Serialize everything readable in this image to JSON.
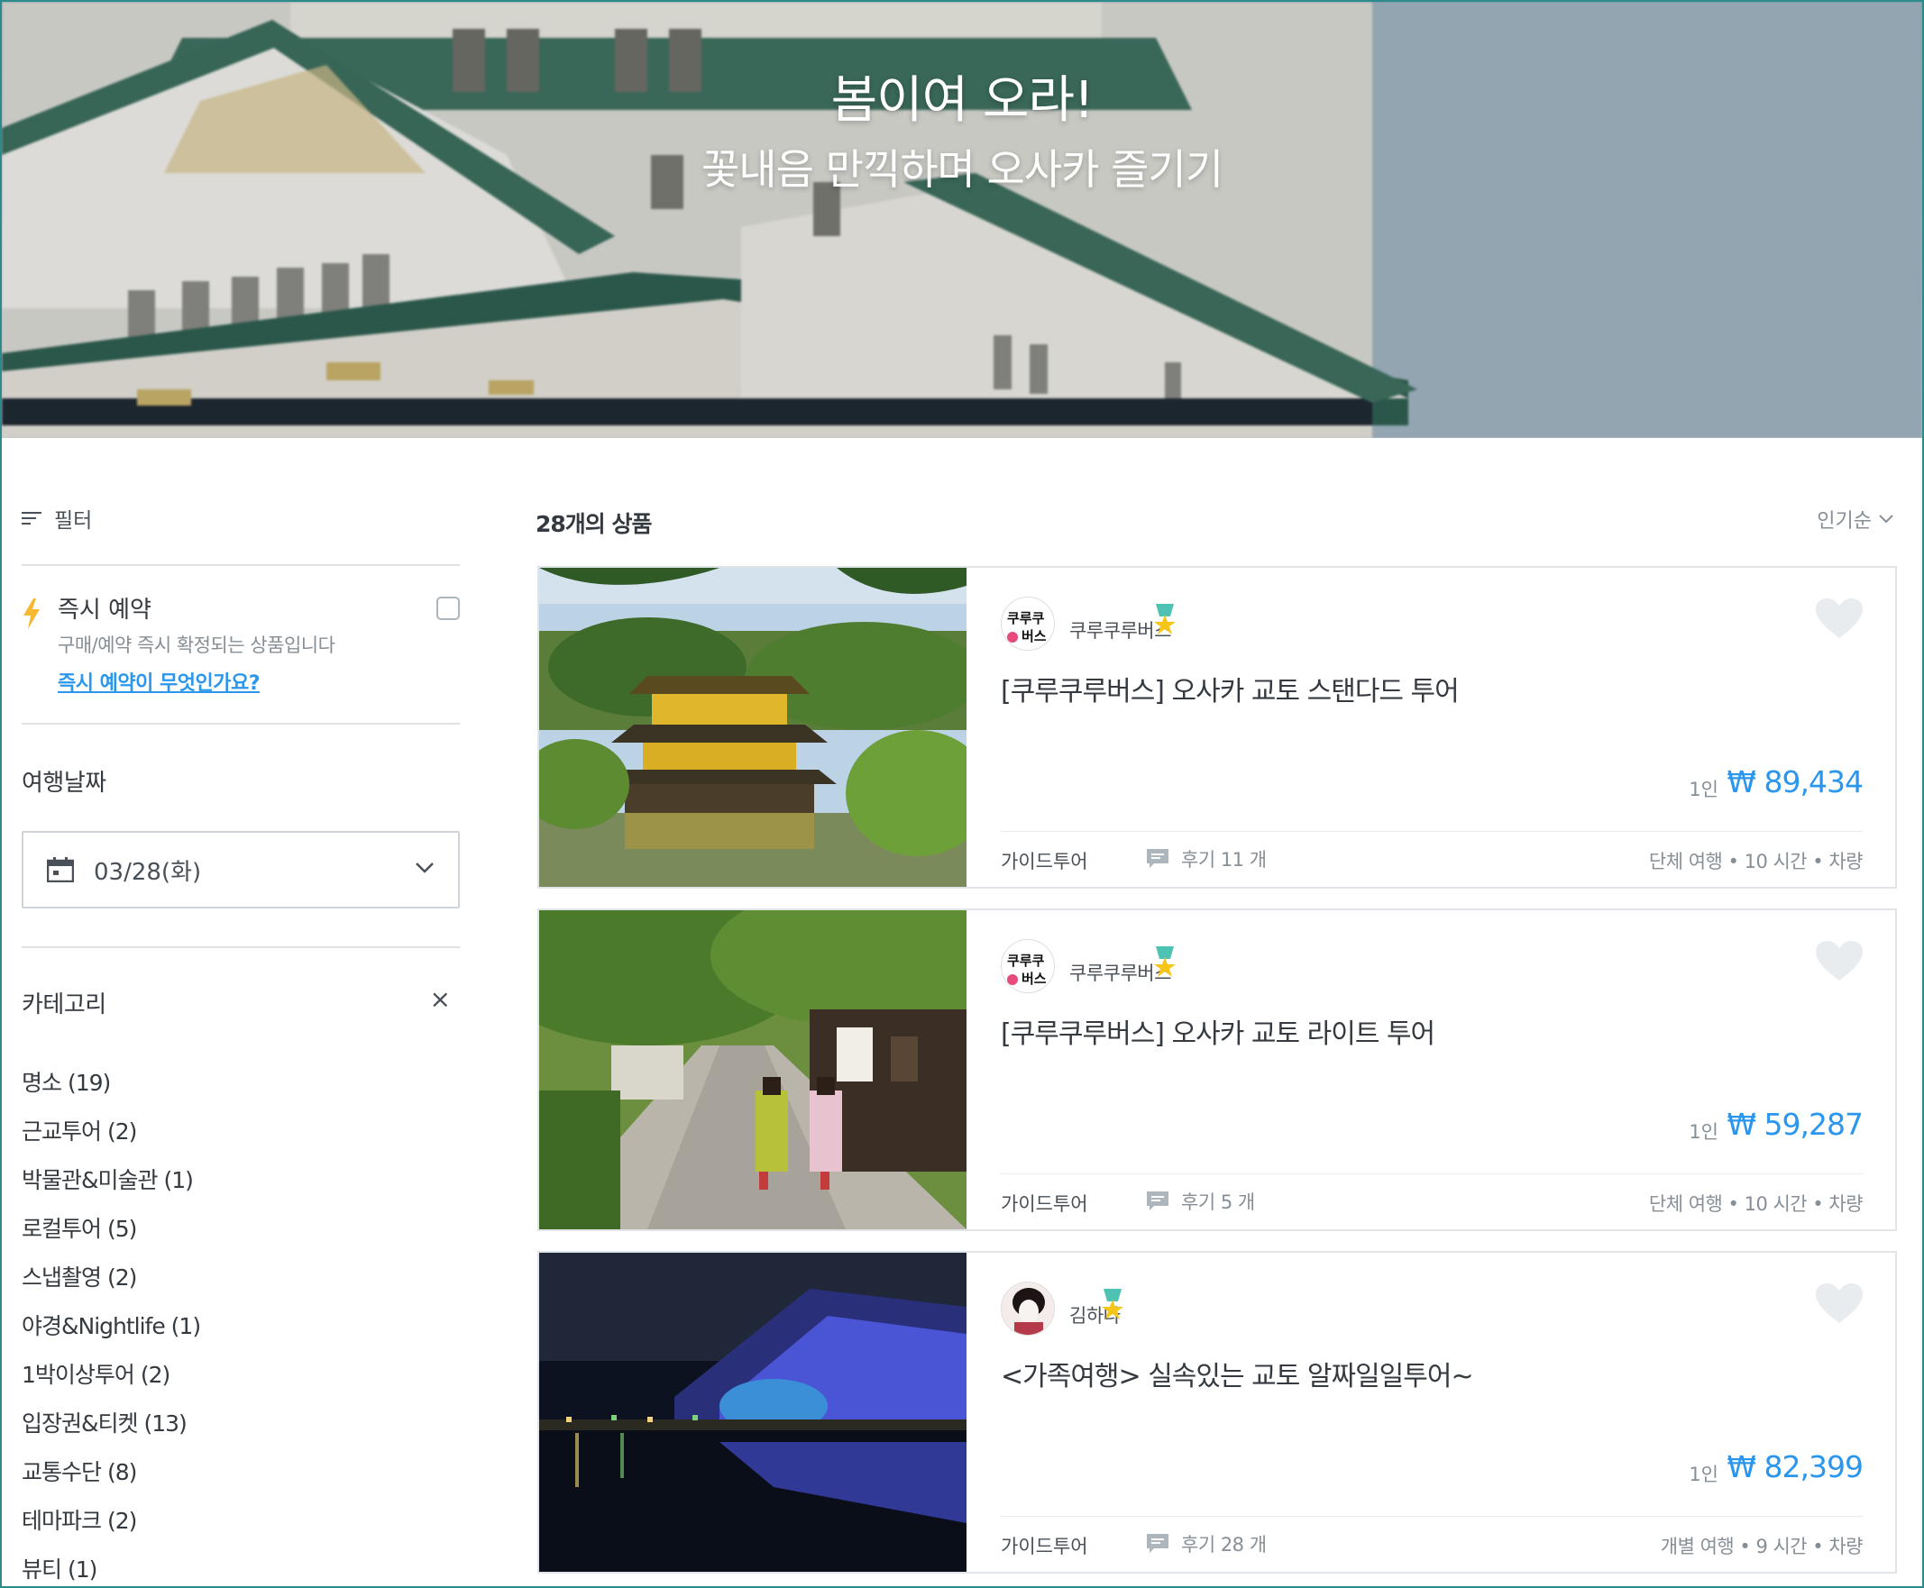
{
  "hero": {
    "title": "봄이여 오라!",
    "subtitle": "꽃내음 만끽하며 오사카 즐기기"
  },
  "sidebar": {
    "filter_label": "필터",
    "instant": {
      "title": "즉시 예약",
      "description": "구매/예약 즉시 확정되는 상품입니다",
      "link": "즉시 예약이 무엇인가요?"
    },
    "date_label": "여행날짜",
    "date_value": "03/28(화)",
    "category_label": "카테고리",
    "category_close": "×",
    "categories": [
      "명소 (19)",
      "근교투어 (2)",
      "박물관&미술관 (1)",
      "로컬투어 (5)",
      "스냅촬영 (2)",
      "야경&Nightlife (1)",
      "1박이상투어 (2)",
      "입장권&티켓 (13)",
      "교통수단 (8)",
      "테마파크 (2)",
      "뷰티 (1)"
    ]
  },
  "main": {
    "count": "28개의 상품",
    "sort": "인기순",
    "products": [
      {
        "host": "쿠루쿠루버스",
        "avatar_text": "쿠루쿠루버스",
        "title": "[쿠루쿠루버스] 오사카 교토 스탠다드 투어",
        "per": "1인",
        "price": "₩ 89,434",
        "type": "가이드투어",
        "reviews": "후기 11 개",
        "meta": "단체 여행 • 10 시간 • 차량"
      },
      {
        "host": "쿠루쿠루버스",
        "avatar_text": "쿠루쿠루버스",
        "title": "[쿠루쿠루버스] 오사카 교토 라이트 투어",
        "per": "1인",
        "price": "₩ 59,287",
        "type": "가이드투어",
        "reviews": "후기 5 개",
        "meta": "단체 여행 • 10 시간 • 차량"
      },
      {
        "host": "김하나",
        "avatar_text": "",
        "title": "<가족여행> 실속있는 교토 알짜일일투어~",
        "per": "1인",
        "price": "₩ 82,399",
        "type": "가이드투어",
        "reviews": "후기 28 개",
        "meta": "개별 여행 • 9 시간 • 차량"
      }
    ]
  },
  "colors": {
    "accent": "#2b96ed",
    "badge_ribbon": "#4fc3b3",
    "badge_star": "#f5c518",
    "bolt": "#f7b731"
  }
}
